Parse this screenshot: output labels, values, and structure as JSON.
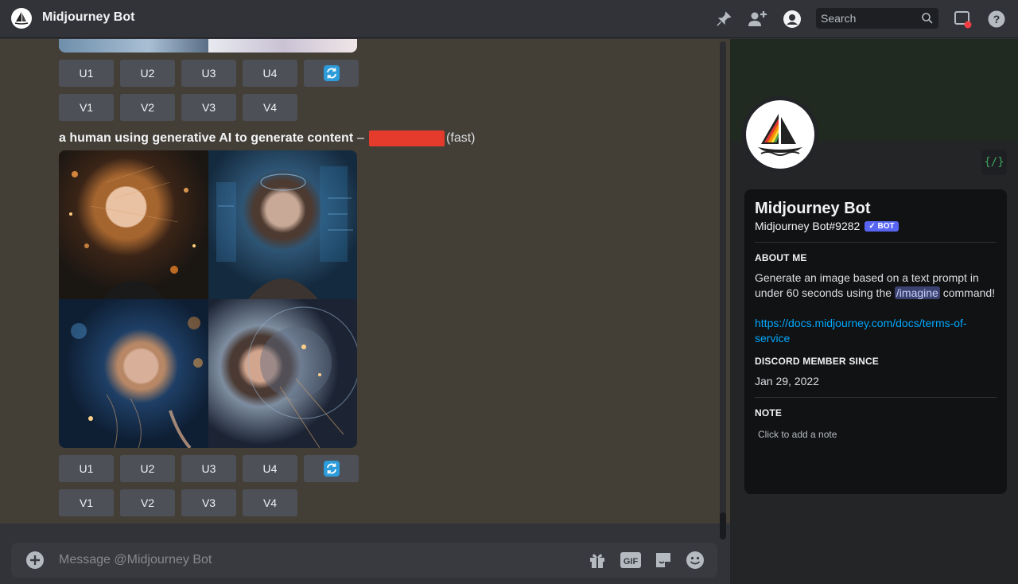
{
  "header": {
    "title": "Midjourney Bot",
    "search_placeholder": "Search"
  },
  "message": {
    "prompt_text": "a human using generative AI to generate content",
    "separator": "–",
    "speed": "(fast)",
    "upscale_labels": [
      "U1",
      "U2",
      "U3",
      "U4"
    ],
    "variation_labels": [
      "V1",
      "V2",
      "V3",
      "V4"
    ]
  },
  "composer": {
    "placeholder": "Message @Midjourney Bot"
  },
  "profile": {
    "name": "Midjourney Bot",
    "tag": "Midjourney Bot#9282",
    "bot_badge": "✓ BOT",
    "code_badge": "{/}",
    "about_heading": "ABOUT ME",
    "about_text_1": "Generate an image based on a text prompt in under 60 seconds using the",
    "about_command": "/imagine",
    "about_text_2": "command!",
    "link": "https://docs.midjourney.com/docs/terms-of-service",
    "member_since_heading": "DISCORD MEMBER SINCE",
    "member_since": "Jan 29, 2022",
    "note_heading": "NOTE",
    "note_placeholder": "Click to add a note"
  },
  "colors": {
    "accent": "#5865f2",
    "link": "#00a8fc",
    "redaction": "#e53b2c",
    "refresh_icon": "#2d9cdb"
  },
  "icons": [
    "pin-icon",
    "add-member-icon",
    "profile-icon",
    "search-icon",
    "inbox-icon",
    "help-icon",
    "refresh-icon",
    "plus-icon",
    "gift-icon",
    "gif-icon",
    "sticker-icon",
    "emoji-icon"
  ]
}
